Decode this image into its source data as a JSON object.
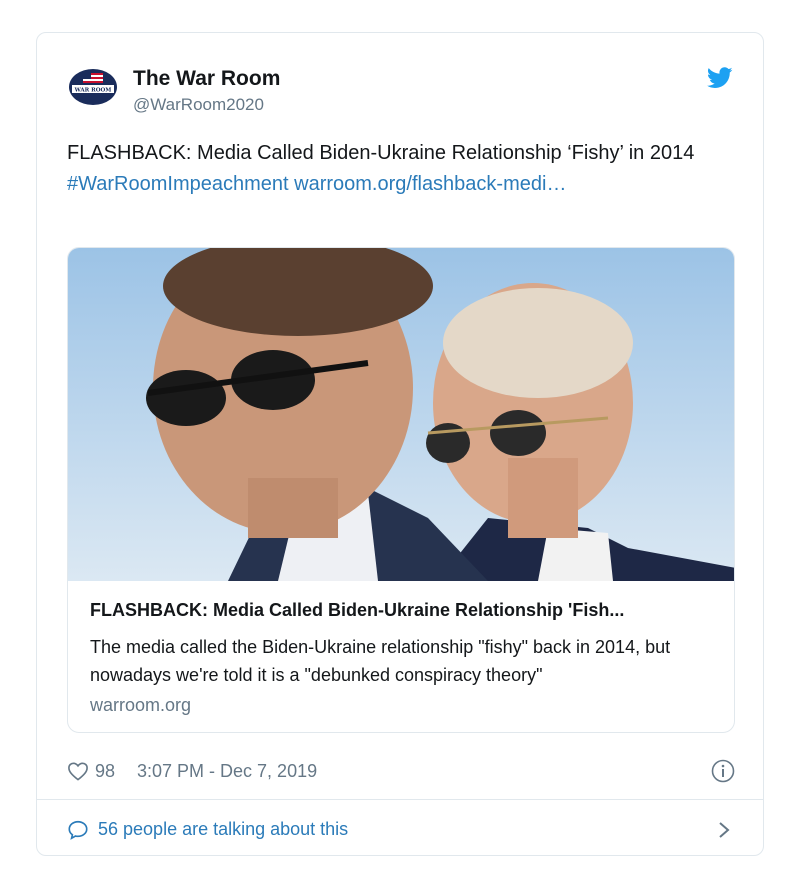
{
  "author": {
    "name": "The War Room",
    "handle": "@WarRoom2020",
    "avatar_icon": "war-room-logo",
    "avatar_text": "WAR ROOM"
  },
  "tweet": {
    "text": "FLASHBACK: Media Called Biden-Ukraine Relationship ‘Fishy’ in 2014 ",
    "hashtag": "#WarRoomImpeachment",
    "link": "warroom.org/flashback-medi…"
  },
  "card": {
    "image_icon": "article-photo",
    "title": "FLASHBACK: Media Called Biden-Ukraine Relationship 'Fish...",
    "description": "The media called the Biden-Ukraine relationship \"fishy\" back in 2014, but nowadays we're told it is a \"debunked conspiracy theory\"",
    "domain": "warroom.org"
  },
  "meta": {
    "like_count": "98",
    "timestamp": "3:07 PM - Dec 7, 2019"
  },
  "conversation": {
    "label": "56 people are talking about this"
  },
  "colors": {
    "link": "#2b7bb9",
    "twitter_blue": "#1da1f2",
    "secondary_text": "#657786",
    "border": "#e1e8ed"
  }
}
